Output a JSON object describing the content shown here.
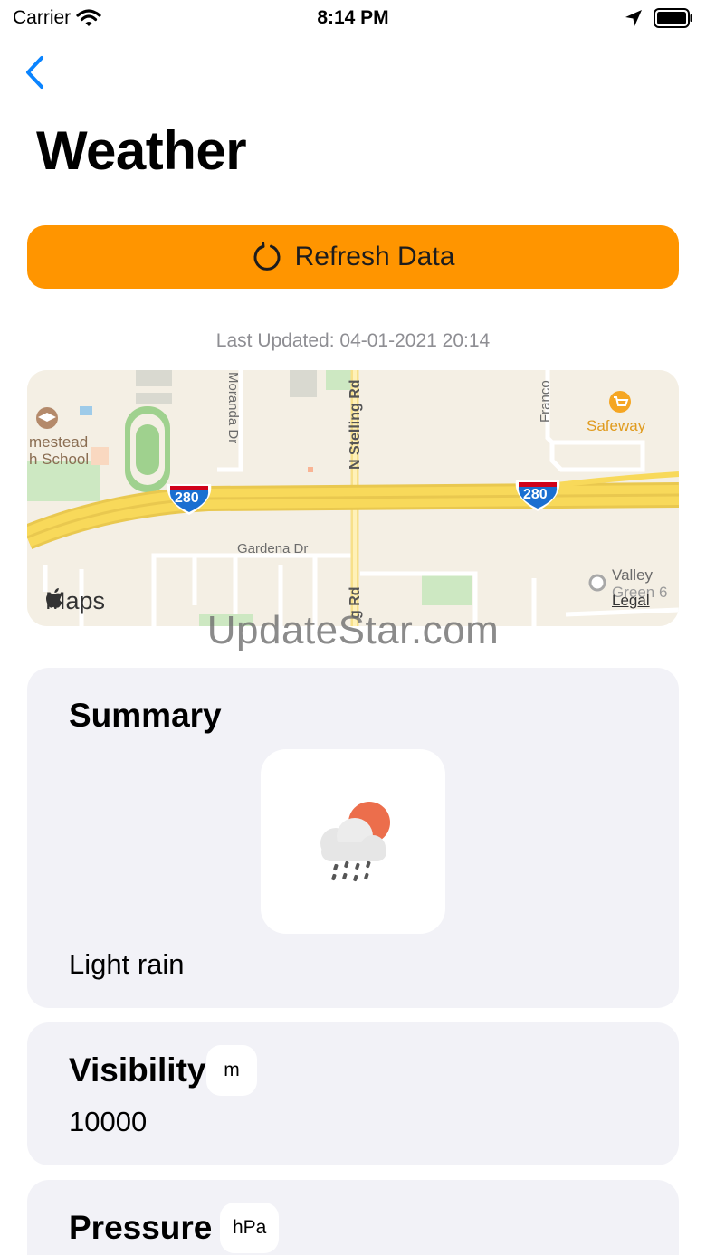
{
  "status_bar": {
    "carrier": "Carrier",
    "time": "8:14 PM"
  },
  "header": {
    "title": "Weather"
  },
  "refresh": {
    "label": "Refresh Data",
    "color": "#ff9500"
  },
  "last_updated": "Last Updated: 04-01-2021 20:14",
  "map": {
    "labels": {
      "school_line1": "mestead",
      "school_line2": "h School",
      "road_moranda": "Moranda Dr",
      "road_stelling": "N Stelling Rd",
      "road_stelling_south": "g Rd",
      "road_franco": "Franco",
      "store": "Safeway",
      "highway_shield_left": "280",
      "highway_shield_right": "280",
      "road_gardena": "Gardena Dr",
      "theater_line1": "Valley",
      "theater_line2": "Green 6"
    },
    "logo": "Maps",
    "legal": "Legal"
  },
  "watermark": "UpdateStar.com",
  "summary": {
    "heading": "Summary",
    "icon": "cloud-rain-sun-icon",
    "description": "Light rain"
  },
  "visibility": {
    "heading": "Visibility",
    "unit": "m",
    "value": "10000"
  },
  "pressure": {
    "heading": "Pressure",
    "unit": "hPa"
  }
}
